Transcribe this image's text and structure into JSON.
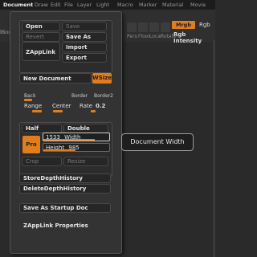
{
  "menubar": {
    "items": [
      "Document",
      "Draw",
      "Edit",
      "File",
      "Layer",
      "Light",
      "Macro",
      "Marker",
      "Material",
      "Movie"
    ]
  },
  "background": {
    "left_label": "lBox",
    "ghost_labels": [
      "Pers",
      "Floor",
      "Local",
      "Rotate"
    ],
    "mrgb": "Mrgb",
    "rgb": "Rgb",
    "rgb_intensity": "Rgb Intensity"
  },
  "panel": {
    "open": "Open",
    "save": "Save",
    "revert": "Revert",
    "save_as": "Save As",
    "import": "Import",
    "export": "Export",
    "zapplink": "ZAppLink",
    "new_document": "New Document",
    "wsize": "WSize",
    "back": "Back",
    "border": "Border",
    "border2": "Border2",
    "range": "Range",
    "center": "Center",
    "rate_label": "Rate",
    "rate_value": "0.2",
    "half": "Half",
    "double": "Double",
    "pro": "Pro",
    "width_value": "1533",
    "width_label": "Width",
    "height_label": "Height",
    "height_value": "985",
    "crop": "Crop",
    "resize": "Resize",
    "store_depth_history": "StoreDepthHistory",
    "delete_depth_history": "DeleteDepthHistory",
    "save_as_startup_doc": "Save As Startup Doc",
    "zapplink_properties": "ZAppLink Properties"
  },
  "tooltip": {
    "text": "Document Width"
  },
  "colors": {
    "accent": "#e07e1f",
    "panel_bg": "#333333",
    "button_bg": "#262626"
  }
}
